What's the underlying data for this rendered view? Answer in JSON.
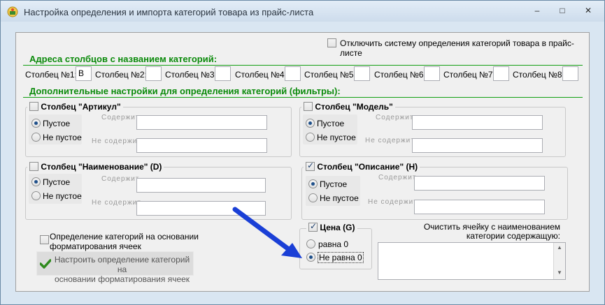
{
  "window": {
    "title": "Настройка определения и импорта категорий товара из прайс-листа",
    "minimize": "–",
    "maximize": "□",
    "close": "✕"
  },
  "disable_system_label": "Отключить систему определения категорий товара в прайс-листе",
  "columns_section": {
    "title": "Адреса столбцов с названием категорий:",
    "fields": [
      {
        "label": "Столбец №1:",
        "value": "B"
      },
      {
        "label": "Столбец №2:",
        "value": ""
      },
      {
        "label": "Столбец №3:",
        "value": ""
      },
      {
        "label": "Столбец №4:",
        "value": ""
      },
      {
        "label": "Столбец №5:",
        "value": ""
      },
      {
        "label": "Столбец №6:",
        "value": ""
      },
      {
        "label": "Столбец №7:",
        "value": ""
      },
      {
        "label": "Столбец №8:",
        "value": ""
      }
    ]
  },
  "filters_section": {
    "title": "Дополнительные настройки для определения категорий (фильтры):",
    "contains_label": "Содержит",
    "not_contains_label": "Не содержит",
    "empty_label": "Пустое",
    "not_empty_label": "Не пустое",
    "groups": {
      "article": {
        "title": "Столбец \"Артикул\"",
        "checked": false
      },
      "model": {
        "title": "Столбец \"Модель\"",
        "checked": false
      },
      "name": {
        "title": "Столбец \"Наименование\" (D)",
        "checked": false
      },
      "description": {
        "title": "Столбец \"Описание\" (H)",
        "checked": true
      }
    }
  },
  "formatting": {
    "checkbox_label_1": "Определение категорий на основании",
    "checkbox_label_2": "форматирования ячеек",
    "button_label_1": "Настроить определение категорий на",
    "button_label_2": "основании форматирования ячеек"
  },
  "price": {
    "title": "Цена (G)",
    "checked": true,
    "equals_zero": "равна 0",
    "not_equals_zero": "Не равна 0"
  },
  "clear_cell": {
    "label_1": "Очистить ячейку с наименованием",
    "label_2": "категории содержащую:",
    "value": ""
  },
  "colors": {
    "accent_green": "#0a8a0a",
    "arrow_blue": "#1a3fd6"
  }
}
